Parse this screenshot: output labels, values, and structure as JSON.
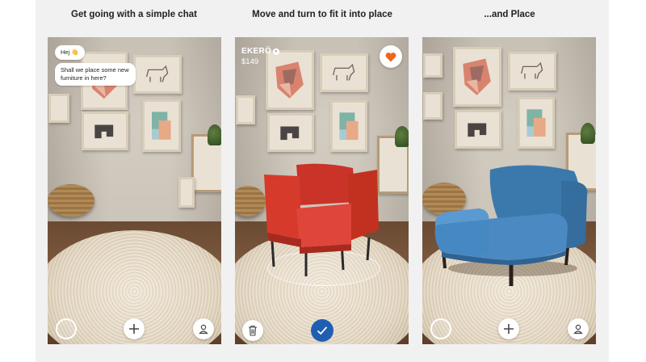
{
  "panels": [
    {
      "title": "Get going with a simple chat",
      "bubbles": [
        "Hej 👋",
        "Shall we place some new furniture in here?"
      ]
    },
    {
      "title": "Move and turn to fit it into place",
      "product": {
        "name": "EKERÖ",
        "price": "$149",
        "chair_color": "#d63a2b"
      }
    },
    {
      "title": "...and Place",
      "product": {
        "chair_color": "#3f82b8"
      }
    }
  ],
  "icons": {
    "capture": "capture-circle-icon",
    "add": "plus-icon",
    "profile": "profile-icon",
    "delete": "trash-icon",
    "confirm": "checkmark-icon",
    "favorite": "heart-icon"
  },
  "colors": {
    "favorite": "#f0651c",
    "confirm": "#1f5fb3"
  }
}
